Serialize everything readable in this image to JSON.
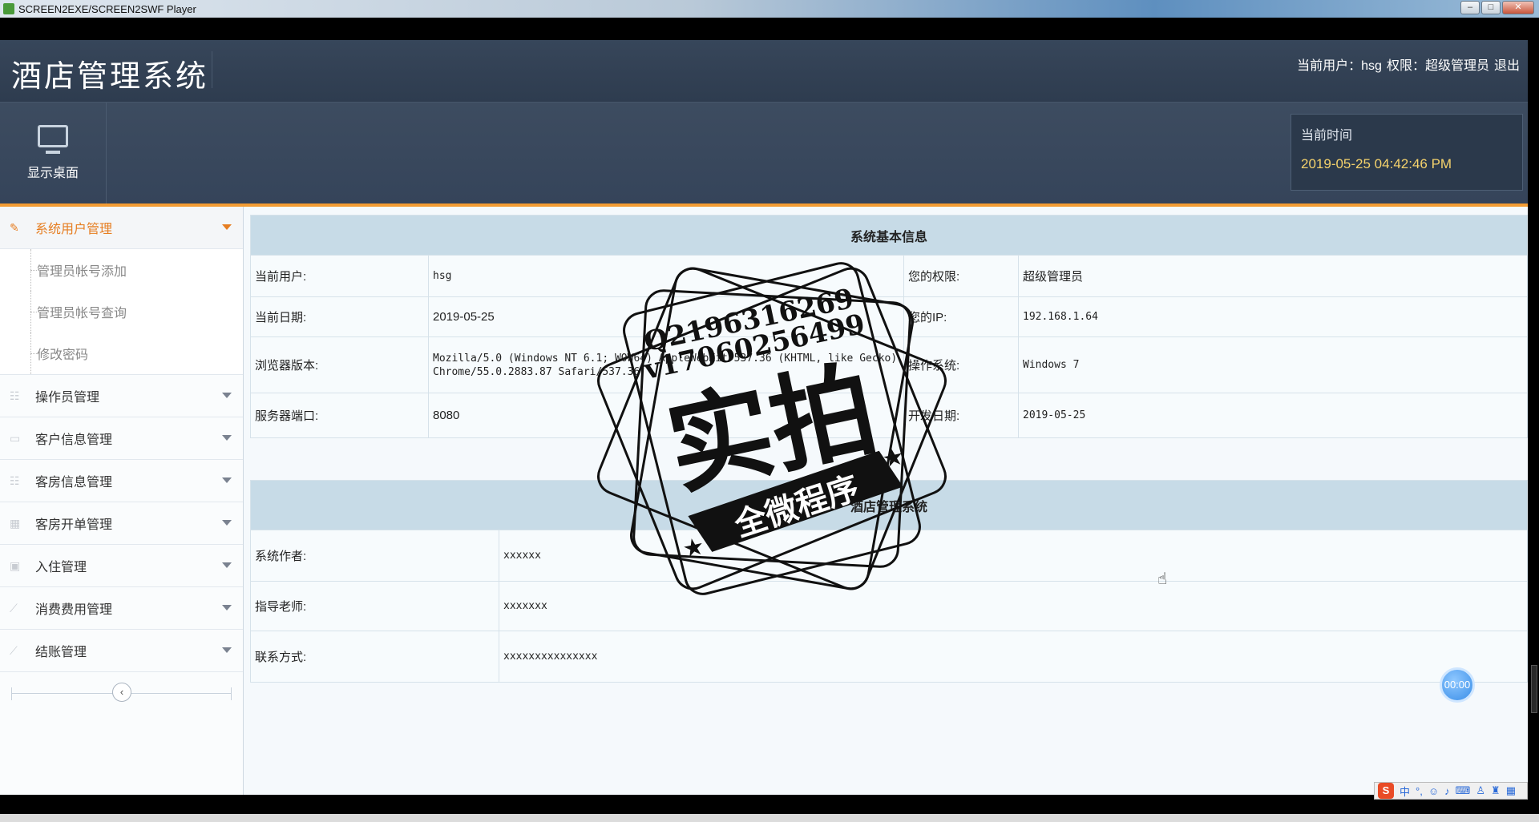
{
  "player": {
    "title": "SCREEN2EXE/SCREEN2SWF Player",
    "min": "–",
    "max": "□",
    "close": "✕"
  },
  "header": {
    "system_title": "酒店管理系统",
    "current_user_label": "当前用户：",
    "current_user": "hsg",
    "role_label": "权限：",
    "role": "超级管理员",
    "logout": "退出"
  },
  "toolbar": {
    "show_desktop": "显示桌面",
    "clock_label": "当前时间",
    "clock_time": "2019-05-25 04:42:46 PM"
  },
  "sidebar": {
    "items": [
      {
        "label": "系统用户管理",
        "icon": "pencil-icon",
        "active": true
      },
      {
        "label": "操作员管理",
        "icon": "list-icon"
      },
      {
        "label": "客户信息管理",
        "icon": "monitor-icon"
      },
      {
        "label": "客房信息管理",
        "icon": "list-icon"
      },
      {
        "label": "客房开单管理",
        "icon": "grid-icon"
      },
      {
        "label": "入住管理",
        "icon": "calendar-icon"
      },
      {
        "label": "消费费用管理",
        "icon": "brush-icon"
      },
      {
        "label": "结账管理",
        "icon": "brush-icon"
      }
    ],
    "sub_items": [
      {
        "label": "管理员帐号添加"
      },
      {
        "label": "管理员帐号查询"
      },
      {
        "label": "修改密码"
      }
    ],
    "collapse": "‹"
  },
  "system_info": {
    "title": "系统基本信息",
    "current_user_label": "当前用户:",
    "current_user": "hsg",
    "permission_label": "您的权限:",
    "permission": "超级管理员",
    "date_label": "当前日期:",
    "date": "2019-05-25",
    "ip_label": "您的IP:",
    "ip": "192.168.1.64",
    "browser_label": "浏览器版本:",
    "browser": "Mozilla/5.0 (Windows NT 6.1; WOW64) AppleWebKit/537.36 (KHTML, like Gecko) Chrome/55.0.2883.87 Safari/537.36",
    "os_label": "操作系统:",
    "os": "Windows 7",
    "port_label": "服务器端口:",
    "port": "8080",
    "dev_date_label": "开发日期:",
    "dev_date": "2019-05-25"
  },
  "about": {
    "title": "酒店管理系统",
    "author_label": "系统作者:",
    "author": "xxxxxx",
    "teacher_label": "指导老师:",
    "teacher": "xxxxxxx",
    "contact_label": "联系方式:",
    "contact": "xxxxxxxxxxxxxxx"
  },
  "watermark": {
    "line1": "Q2196316269",
    "line2": "v17060256499",
    "big": "实拍",
    "banner": "全微程序"
  },
  "timer": "00:00",
  "ime": {
    "s": "S",
    "lang": "中"
  }
}
